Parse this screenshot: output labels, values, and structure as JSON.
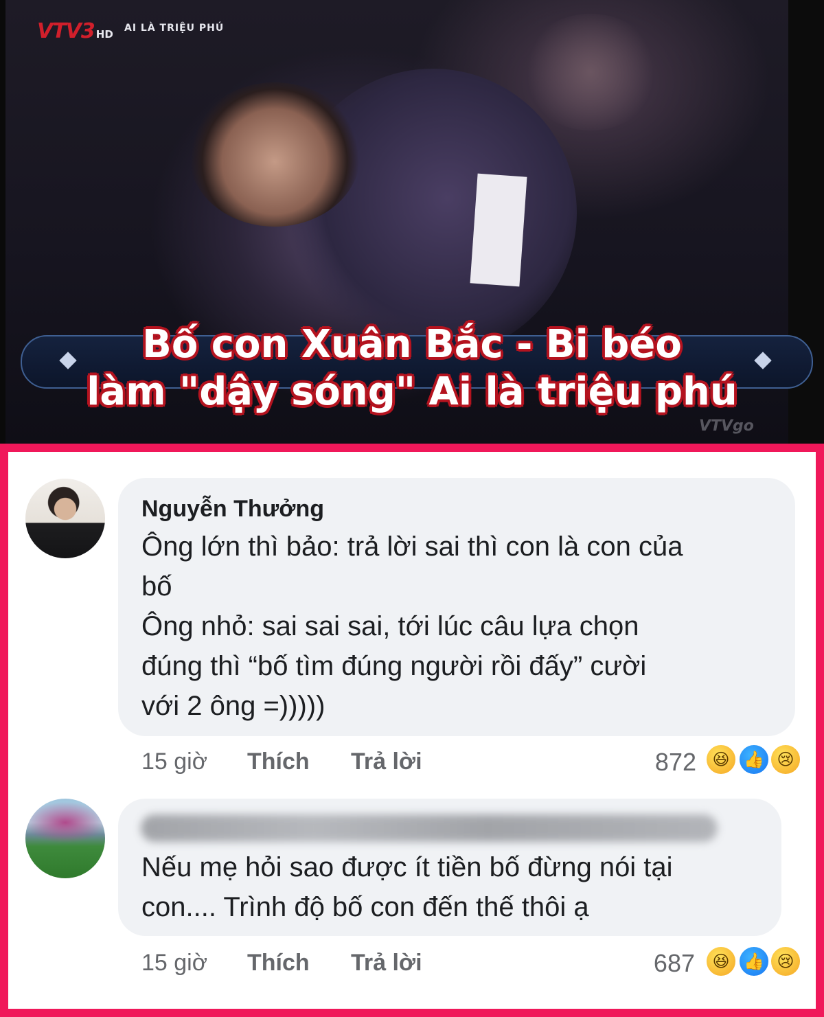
{
  "video": {
    "channel_logo": "VTV3",
    "channel_hd": "HD",
    "show_name": "AI LÀ TRIỆU PHÚ",
    "headline_line1": "Bố con Xuân Bắc - Bi béo",
    "headline_line2": "làm \"dậy sóng\" Ai là triệu phú",
    "watermark": "VTVgo",
    "icons": [
      "vtv3-logo",
      "diamond-icon",
      "vtvgo-watermark"
    ]
  },
  "colors": {
    "headline_text": "#ffffff",
    "headline_outline": "#b4131f",
    "panel_border": "#f0185a",
    "bubble": "#f0f2f5",
    "meta_text": "#65676b"
  },
  "comments": [
    {
      "author": "Nguyễn Thưởng",
      "text": "Ông lớn thì bảo: trả lời sai thì con là con của\nbố\nÔng nhỏ: sai sai sai, tới lúc câu lựa chọn\nđúng thì “bố tìm đúng người rồi đấy” cười\nvới 2 ông =)))))",
      "time": "15 giờ",
      "like_label": "Thích",
      "reply_label": "Trả lời",
      "reaction_count": "872",
      "reactions": [
        "haha-icon",
        "like-icon",
        "sad-icon"
      ]
    },
    {
      "author": "",
      "text": "Nếu mẹ hỏi sao được ít tiền bố đừng nói tại\ncon.... Trình độ bố con đến thế thôi ạ",
      "time": "15 giờ",
      "like_label": "Thích",
      "reply_label": "Trả lời",
      "reaction_count": "687",
      "reactions": [
        "haha-icon",
        "like-icon",
        "sad-icon"
      ]
    }
  ]
}
